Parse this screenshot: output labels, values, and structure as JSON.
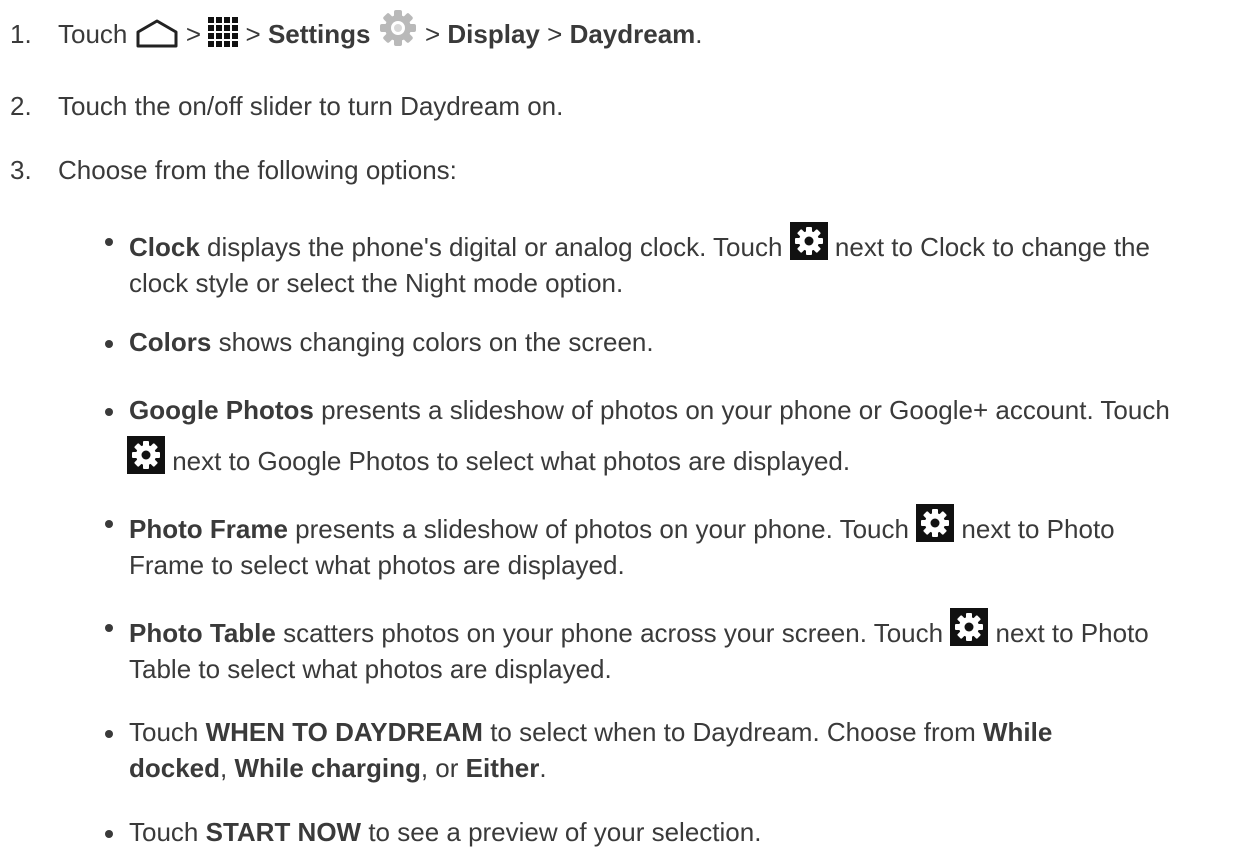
{
  "steps": [
    {
      "number": "1.",
      "touch": "Touch",
      "sep1": ">",
      "sep2": ">",
      "settings": "Settings",
      "sep3": ">",
      "display": "Display",
      "sep4": ">",
      "daydream": "Daydream",
      "end": "."
    },
    {
      "number": "2.",
      "text": "Touch the on/off slider to turn Daydream on."
    },
    {
      "number": "3.",
      "text": "Choose from the following options:"
    }
  ],
  "options": [
    {
      "name": "Clock",
      "line1_pre": " displays the phone's digital or analog clock. Touch ",
      "line1_post": " next to Clock to change the",
      "line2": "clock style or select the Night mode option."
    },
    {
      "name": "Colors",
      "text": " shows changing colors on the screen."
    },
    {
      "name": "Google Photos",
      "line1": " presents a slideshow of photos on your phone or Google+ account. Touch",
      "line2": " next to Google Photos to select what photos are displayed."
    },
    {
      "name": "Photo Frame",
      "line1_pre": " presents a slideshow of photos on your phone. Touch ",
      "line1_post": " next to Photo",
      "line2": "Frame to select what photos are displayed."
    },
    {
      "name": "Photo Table",
      "line1_pre": " scatters photos on your phone across your screen. Touch ",
      "line1_post": " next to Photo",
      "line2": "Table to select what photos are displayed."
    },
    {
      "pre": "Touch ",
      "bold1": "WHEN TO DAYDREAM",
      "mid": " to select when to Daydream. Choose from ",
      "bold2": "While",
      "bold3": "docked",
      "comma1": ", ",
      "bold4": "While charging",
      "comma2": ", or ",
      "bold5": "Either",
      "end": "."
    },
    {
      "pre": "Touch ",
      "bold": "START NOW",
      "post": " to see a preview of your selection."
    }
  ],
  "icons": {
    "home": "home-icon",
    "apps": "apps-grid-icon",
    "settings": "settings-gear-icon",
    "gear": "gear-icon"
  }
}
